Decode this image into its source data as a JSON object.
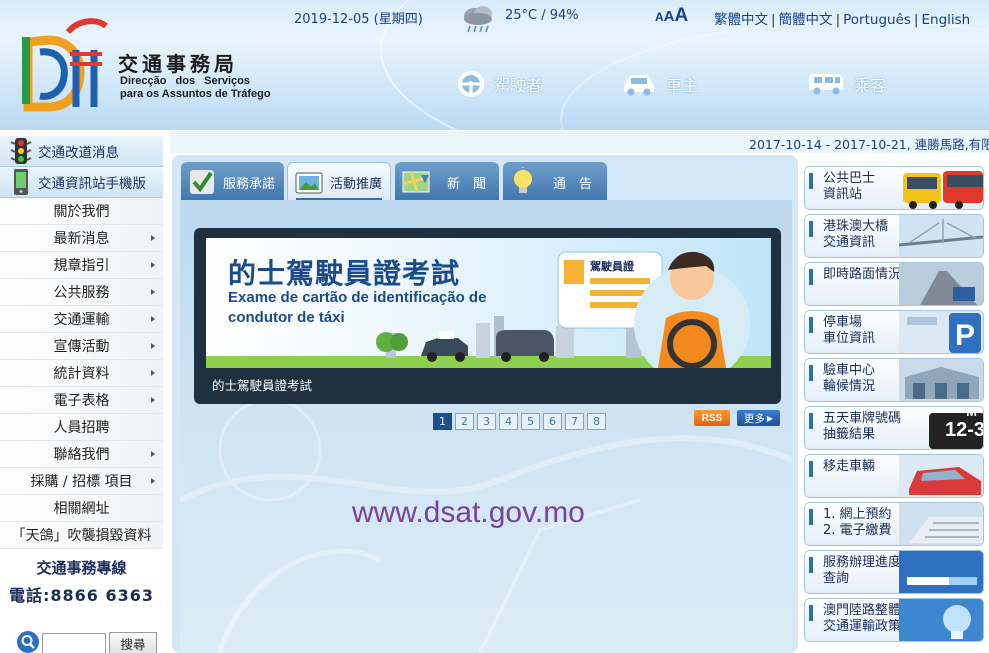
{
  "header": {
    "logo_title": "交通事務局",
    "logo_pt_line1": "Direcção dos Serviços",
    "logo_pt_line2": "para os Assuntos de Tráfego",
    "date": "2019-12-05 (星期四)",
    "weather": "25°C / 94%",
    "fontsize": [
      "A",
      "A",
      "A"
    ],
    "languages": [
      "繁體中文",
      "簡體中文",
      "Português",
      "English"
    ],
    "roles": [
      "駕駛者",
      "車主",
      "乘客"
    ]
  },
  "marquee": "2017-10-14 - 2017-10-21, 連勝馬路,有限",
  "sidebar": {
    "top_items": [
      "交通改道消息",
      "交通資訊站手機版"
    ],
    "menu": [
      {
        "label": "關於我們",
        "arrow": false
      },
      {
        "label": "最新消息",
        "arrow": true
      },
      {
        "label": "規章指引",
        "arrow": true
      },
      {
        "label": "公共服務",
        "arrow": true
      },
      {
        "label": "交通運輸",
        "arrow": true
      },
      {
        "label": "宣傳活動",
        "arrow": true
      },
      {
        "label": "統計資料",
        "arrow": true
      },
      {
        "label": "電子表格",
        "arrow": true
      },
      {
        "label": "人員招聘",
        "arrow": false
      },
      {
        "label": "聯絡我們",
        "arrow": true
      },
      {
        "label": "採購 / 招標 項目",
        "arrow": true
      },
      {
        "label": "相關網址",
        "arrow": false
      },
      {
        "label": "「天鴿」吹襲損毀資料",
        "arrow": false
      }
    ],
    "hotline_title": "交通事務專線",
    "hotline_phone": "電話:8866 6363",
    "search_button": "搜尋",
    "search_value": ""
  },
  "tabs": [
    {
      "label": "服務承諾",
      "active": false
    },
    {
      "label": "活動推廣",
      "active": true
    },
    {
      "label": "新　聞",
      "active": false
    },
    {
      "label": "通　告",
      "active": false
    }
  ],
  "banner": {
    "title": "的士駕駛員證考試",
    "pt_line1": "Exame de cartão de identificação de",
    "pt_line2": "condutor de táxi",
    "card_label": "駕駛員證",
    "caption": "的士駕駛員證考試"
  },
  "pager": {
    "pages": [
      "1",
      "2",
      "3",
      "4",
      "5",
      "6",
      "7",
      "8"
    ],
    "current": 1
  },
  "rss_label": "RSS",
  "more_label": "更多",
  "url": "www.dsat.gov.mo",
  "right_links": [
    {
      "line1": "公共巴士",
      "line2": "資訊站",
      "art": "bus"
    },
    {
      "line1": "港珠澳大橋",
      "line2": "交通資訊",
      "art": "bridge"
    },
    {
      "line1": "即時路面情況",
      "line2": "",
      "art": "road"
    },
    {
      "line1": "停車場",
      "line2": "車位資訊",
      "art": "parking"
    },
    {
      "line1": "驗車中心",
      "line2": "輪候情況",
      "art": "building"
    },
    {
      "line1": "五天車牌號碼",
      "line2": "抽籤結果",
      "art": "plate"
    },
    {
      "line1": "移走車輛",
      "line2": "",
      "art": "car"
    },
    {
      "line1": "1. 網上預約",
      "line2": "2. 電子繳費",
      "art": "keyboard"
    },
    {
      "line1": "服務辦理進度",
      "line2": "查詢",
      "art": "progress"
    },
    {
      "line1": "澳門陸路整體",
      "line2": "交通運輸政策",
      "art": "bulb"
    }
  ],
  "right_plate_text": "12-3",
  "right_plate_top": "M",
  "colors": {
    "nav_blue": "#1a3f8a",
    "tab_blue": "#3f75ad",
    "url_purple": "#7b3f9e",
    "rss_orange": "#e0620d"
  }
}
